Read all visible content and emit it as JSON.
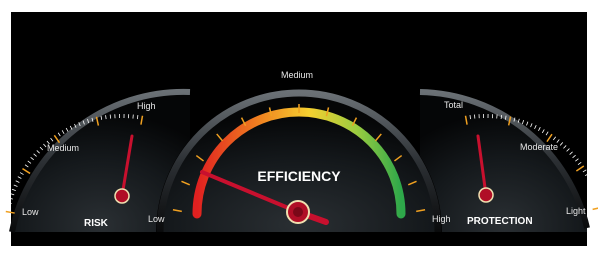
{
  "gauges": {
    "risk": {
      "title": "RISK",
      "labels": {
        "low": "Low",
        "medium": "Medium",
        "high": "High"
      },
      "level": 0.93,
      "needle_color": "#c8102e"
    },
    "efficiency": {
      "title": "EFFICIENCY",
      "labels": {
        "low": "Low",
        "medium": "Medium",
        "high": "High"
      },
      "level": 0.12,
      "needle_color": "#c8102e",
      "arc_colors": [
        "#e02020",
        "#f08020",
        "#f5d030",
        "#9ccc40",
        "#2ea84a"
      ]
    },
    "protection": {
      "title": "PROTECTION",
      "labels": {
        "total": "Total",
        "moderate": "Moderate",
        "light": "Light"
      },
      "level": 0.04,
      "needle_color": "#c8102e"
    }
  },
  "colors": {
    "background": "#000000",
    "tick_minor": "#ffffff",
    "tick_accent": "#f0a020"
  }
}
